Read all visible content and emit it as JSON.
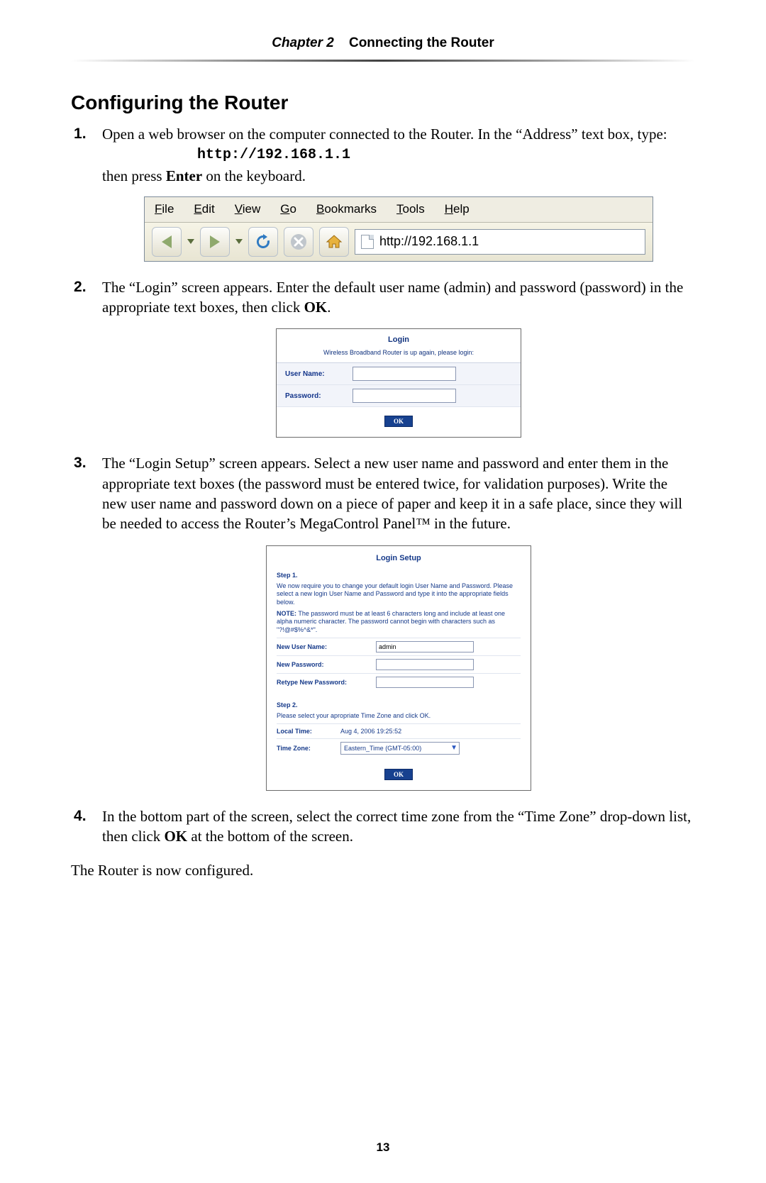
{
  "header": {
    "chapter_label": "Chapter 2",
    "chapter_title": "Connecting the Router"
  },
  "section_title": "Configuring the Router",
  "steps": {
    "s1": {
      "p1a": "Open a web browser on the computer connected to the Router. In the “Address” text box, type:",
      "url": "http://192.168.1.1",
      "p1b_a": "then press ",
      "p1b_bold": "Enter",
      "p1b_b": " on the keyboard."
    },
    "s2": {
      "p_a": "The “Login” screen appears. Enter the default user name (admin) and password (password) in the appropriate text boxes, then click ",
      "p_bold": "OK",
      "p_b": "."
    },
    "s3": {
      "p": "The “Login Setup” screen appears. Select a new user name and password and enter them in the appropriate text boxes (the password must be entered twice, for validation purposes). Write the new user name and password down on a piece of paper and keep it in a safe place, since they will be needed to access the Router’s MegaControl Panel™ in the future."
    },
    "s4": {
      "p_a": "In the bottom part of the screen, select the correct time zone from the “Time Zone” drop-down list, then click ",
      "p_bold": "OK",
      "p_b": " at the bottom of the screen."
    }
  },
  "closing": "The Router is now configured.",
  "page_number": "13",
  "browser": {
    "menu": {
      "file": "File",
      "edit": "Edit",
      "view": "View",
      "go": "Go",
      "bookmarks": "Bookmarks",
      "tools": "Tools",
      "help": "Help"
    },
    "address": "http://192.168.1.1"
  },
  "login_box": {
    "title": "Login",
    "message": "Wireless Broadband Router is up again, please login:",
    "user_label": "User Name:",
    "pass_label": "Password:",
    "ok": "OK"
  },
  "setup_box": {
    "title": "Login Setup",
    "step1": "Step 1.",
    "para1": "We now require you to change your default login User Name and Password. Please select a new login User Name and Password and type it into the appropriate fields below.",
    "note_label": "NOTE:",
    "note_text": " The password must be at least 6 characters long and include at least one alpha numeric character. The password cannot begin with characters such as \"?!@#$%^&*\".",
    "new_user_label": "New User Name:",
    "new_user_value": "admin",
    "new_pass_label": "New Password:",
    "retype_label": "Retype New Password:",
    "step2": "Step 2.",
    "para2": "Please select your apropriate Time Zone and click OK.",
    "local_time_label": "Local Time:",
    "local_time_value": "Aug 4, 2006 19:25:52",
    "tz_label": "Time Zone:",
    "tz_value": "Eastern_Time (GMT-05:00)",
    "ok": "OK"
  }
}
